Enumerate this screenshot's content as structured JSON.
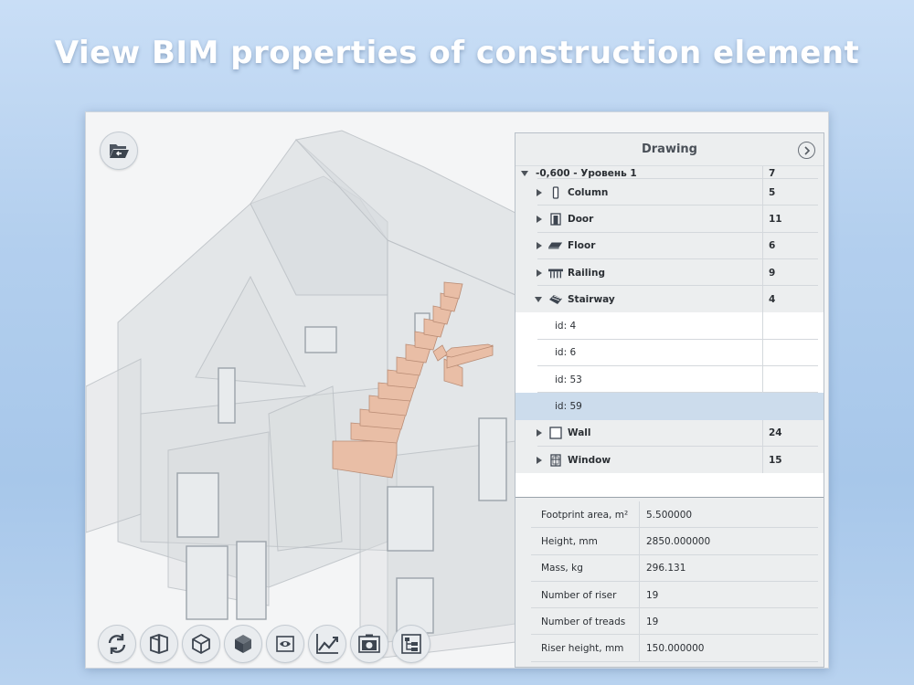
{
  "headline": "View BIM properties of construction element",
  "panel": {
    "title": "Drawing",
    "tree": [
      {
        "type": "group-partial",
        "label": "-0,600 - Уровень 1",
        "count": "7",
        "expanded": true
      },
      {
        "type": "group",
        "label": "Column",
        "count": "5",
        "icon": "column-icon"
      },
      {
        "type": "group",
        "label": "Door",
        "count": "11",
        "icon": "door-icon"
      },
      {
        "type": "group",
        "label": "Floor",
        "count": "6",
        "icon": "floor-icon"
      },
      {
        "type": "group",
        "label": "Railing",
        "count": "9",
        "icon": "railing-icon"
      },
      {
        "type": "group",
        "label": "Stairway",
        "count": "4",
        "icon": "stairway-icon",
        "expanded": true
      },
      {
        "type": "child",
        "label": "id: 4",
        "count": ""
      },
      {
        "type": "child",
        "label": "id: 6",
        "count": ""
      },
      {
        "type": "child",
        "label": "id: 53",
        "count": ""
      },
      {
        "type": "child",
        "label": "id: 59",
        "count": "",
        "selected": true
      },
      {
        "type": "group",
        "label": "Wall",
        "count": "24",
        "icon": "wall-icon"
      },
      {
        "type": "group",
        "label": "Window",
        "count": "15",
        "icon": "window-icon"
      }
    ],
    "properties": [
      {
        "name": "Footprint area, m²",
        "value": "5.500000"
      },
      {
        "name": "Height, mm",
        "value": "2850.000000"
      },
      {
        "name": "Mass, kg",
        "value": "296.131"
      },
      {
        "name": "Number of riser",
        "value": "19"
      },
      {
        "name": "Number of treads",
        "value": "19"
      },
      {
        "name": "Riser height, mm",
        "value": "150.000000"
      }
    ]
  },
  "toolbar": [
    "rotate-icon",
    "section-icon",
    "wireframe-cube-icon",
    "solid-cube-icon",
    "visibility-eye-icon",
    "chart-icon",
    "camera-icon",
    "tree-structure-icon"
  ],
  "colors": {
    "stair": "#e9bea6",
    "selected_row": "#ccdcec",
    "panel_header": "#eceeef"
  }
}
